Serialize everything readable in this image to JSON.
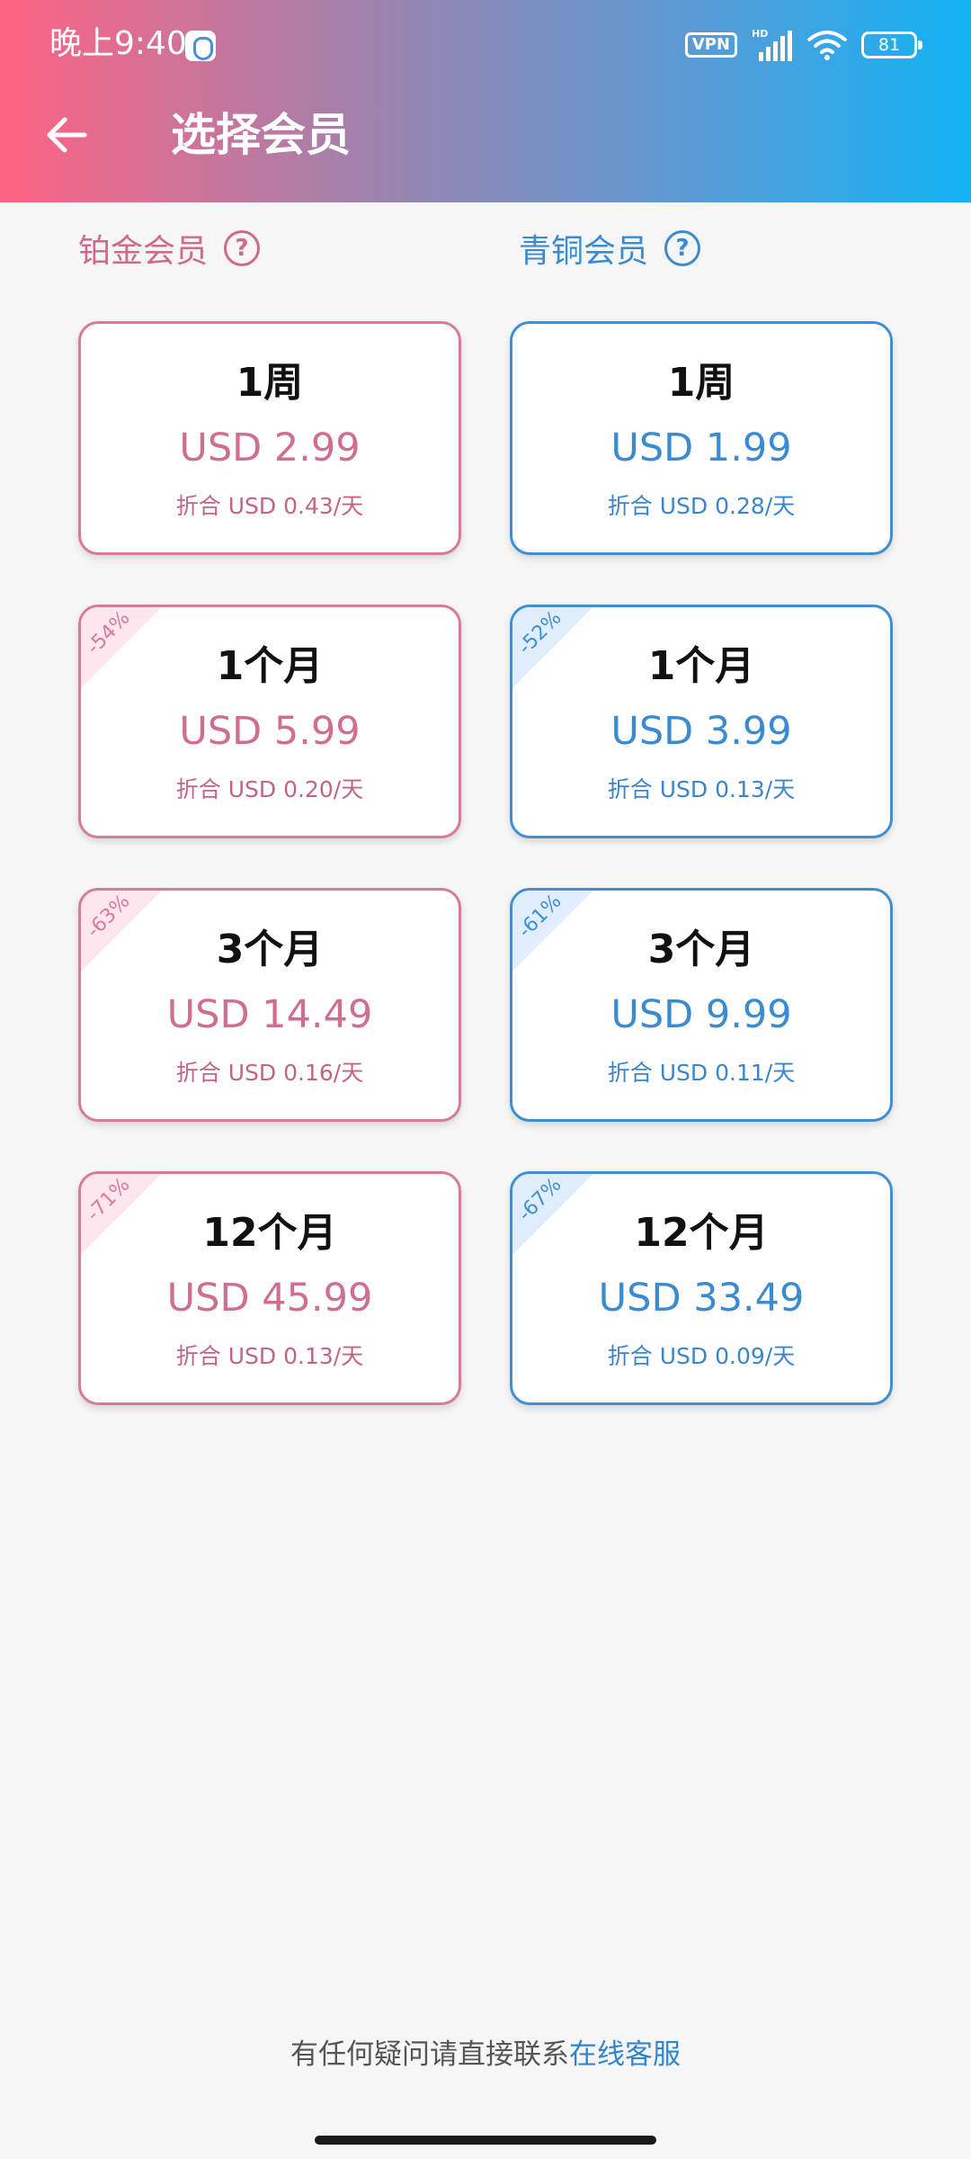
{
  "status_bar": {
    "time": "晚上9:40",
    "vpn": "VPN",
    "battery": "81",
    "icons": [
      "app-shield-icon",
      "vpn-icon",
      "hd-signal-icon",
      "wifi-icon",
      "battery-icon"
    ]
  },
  "header": {
    "title": "选择会员",
    "back_icon": "arrow-left-icon",
    "gradient": [
      "#ff6383",
      "#12b2f4"
    ]
  },
  "columns": {
    "platinum": {
      "label": "铂金会员",
      "help": "?",
      "color": "#cf6a8d"
    },
    "bronze": {
      "label": "青铜会员",
      "help": "?",
      "color": "#3a8bd0"
    }
  },
  "platinum_plans": [
    {
      "period": "1周",
      "price": "USD 2.99",
      "per_day": "折合 USD 0.43/天",
      "discount": ""
    },
    {
      "period": "1个月",
      "price": "USD 5.99",
      "per_day": "折合 USD 0.20/天",
      "discount": "-54%"
    },
    {
      "period": "3个月",
      "price": "USD 14.49",
      "per_day": "折合 USD 0.16/天",
      "discount": "-63%"
    },
    {
      "period": "12个月",
      "price": "USD 45.99",
      "per_day": "折合 USD 0.13/天",
      "discount": "-71%"
    }
  ],
  "bronze_plans": [
    {
      "period": "1周",
      "price": "USD 1.99",
      "per_day": "折合 USD 0.28/天",
      "discount": ""
    },
    {
      "period": "1个月",
      "price": "USD 3.99",
      "per_day": "折合 USD 0.13/天",
      "discount": "-52%"
    },
    {
      "period": "3个月",
      "price": "USD 9.99",
      "per_day": "折合 USD 0.11/天",
      "discount": "-61%"
    },
    {
      "period": "12个月",
      "price": "USD 33.49",
      "per_day": "折合 USD 0.09/天",
      "discount": "-67%"
    }
  ],
  "footer": {
    "text": "有任何疑问请直接联系",
    "link": "在线客服"
  }
}
